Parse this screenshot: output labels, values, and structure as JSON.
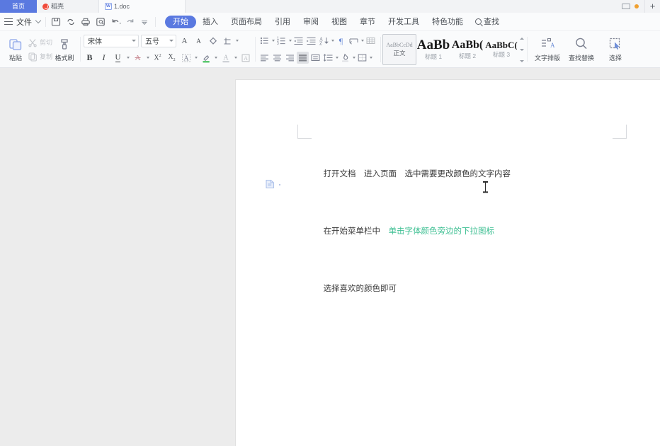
{
  "window": {
    "tabs": [
      {
        "label": "首页",
        "icon": "home-tab",
        "active": true
      },
      {
        "label": "稻壳",
        "icon": "docer-icon",
        "active": false
      },
      {
        "label": "1.doc",
        "icon": "word-doc-icon",
        "active": false
      }
    ],
    "right_controls": {
      "monitor_icon": "monitor-icon",
      "status_dot": "orange-status-dot",
      "new_tab_label": "+"
    }
  },
  "menubar": {
    "menu_icon": "hamburger-menu-icon",
    "file_label": "文件",
    "file_chevron": "chevron-down-icon",
    "quick_access": [
      {
        "name": "save-icon"
      },
      {
        "name": "cloud-sync-icon"
      },
      {
        "name": "print-icon"
      },
      {
        "name": "print-preview-icon"
      },
      {
        "name": "undo-icon"
      },
      {
        "name": "redo-icon"
      },
      {
        "name": "customize-quick-access-icon"
      }
    ],
    "items": [
      {
        "label": "开始",
        "active": true
      },
      {
        "label": "插入",
        "active": false
      },
      {
        "label": "页面布局",
        "active": false
      },
      {
        "label": "引用",
        "active": false
      },
      {
        "label": "审阅",
        "active": false
      },
      {
        "label": "视图",
        "active": false
      },
      {
        "label": "章节",
        "active": false
      },
      {
        "label": "开发工具",
        "active": false
      },
      {
        "label": "特色功能",
        "active": false
      }
    ],
    "find": {
      "label": "查找",
      "icon": "search-icon"
    }
  },
  "ribbon": {
    "clipboard": {
      "paste": {
        "label": "粘贴",
        "icon": "paste-icon",
        "enabled": true
      },
      "cut": {
        "label": "剪切",
        "icon": "scissors-icon",
        "enabled": false
      },
      "copy": {
        "label": "复制",
        "icon": "copy-icon",
        "enabled": false
      },
      "format_painter": {
        "label": "格式刷",
        "icon": "format-painter-icon",
        "enabled": true
      }
    },
    "font": {
      "font_name": "宋体",
      "font_size": "五号",
      "grow_font": "A",
      "shrink_font": "A",
      "clear_format_icon": "clear-format-icon",
      "pinyin_guide_icon": "pinyin-guide-icon",
      "bold": "B",
      "italic": "I",
      "underline": "U",
      "strikethrough": "A",
      "superscript": "X",
      "subscript": "X",
      "char_border": "A",
      "highlight": "highlight-color-icon",
      "font_color": "A",
      "char_shading": "char-shading-icon",
      "highlight_color": "#3dbf54",
      "font_color_value": "#b4b8be"
    },
    "paragraph": {
      "bullets_icon": "bullet-list-icon",
      "numbering_icon": "numbered-list-icon",
      "decrease_indent_icon": "decrease-indent-icon",
      "increase_indent_icon": "increase-indent-icon",
      "sort_icon": "sort-icon",
      "show_marks_icon": "show-formatting-marks-icon",
      "merge_icon": "merge-cells-icon",
      "table_grid_icon": "table-grid-icon",
      "align_left_icon": "align-left-icon",
      "align_center_icon": "align-center-icon",
      "align_right_icon": "align-right-icon",
      "align_justify_icon": "align-justify-icon",
      "distribute_icon": "distribute-text-icon",
      "line_spacing_icon": "line-spacing-icon",
      "shading_icon": "paragraph-shading-icon",
      "borders_icon": "borders-icon"
    },
    "styles": [
      {
        "preview": "AaBbCcDd",
        "label": "正文",
        "selected": true
      },
      {
        "preview": "AaBb",
        "label": "标题 1",
        "selected": false
      },
      {
        "preview": "AaBb(",
        "label": "标题 2",
        "selected": false
      },
      {
        "preview": "AaBbC(",
        "label": "标题 3",
        "selected": false
      }
    ],
    "tools": [
      {
        "label": "文字排版",
        "icon": "text-layout-icon"
      },
      {
        "label": "查找替换",
        "icon": "find-replace-icon"
      },
      {
        "label": "选择",
        "icon": "select-objects-icon"
      }
    ]
  },
  "document": {
    "lines": [
      {
        "plain": "打开文档　进入页面　选中需要更改颜色的文字内容",
        "highlight": ""
      },
      {
        "plain": "在开始菜单栏中　",
        "highlight": "单击字体颜色旁边的下拉图标"
      },
      {
        "plain": "选择喜欢的颜色即可",
        "highlight": ""
      }
    ],
    "highlight_color": "#3dbf92",
    "paste_options_icon": "paste-options-icon",
    "text_cursor": "i-beam-cursor"
  }
}
